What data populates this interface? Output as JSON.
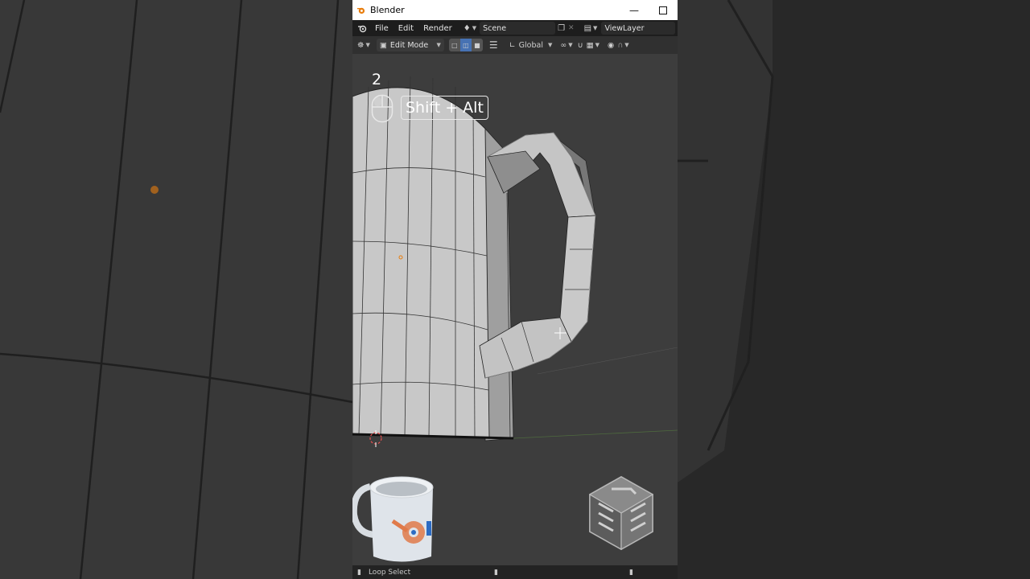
{
  "window": {
    "title": "Blender"
  },
  "menu": {
    "items": [
      "File",
      "Edit",
      "Render"
    ],
    "scene": "Scene",
    "view_layer": "ViewLayer"
  },
  "header": {
    "mode": "Edit Mode",
    "transform_orientation": "Global"
  },
  "overlay": {
    "number": "2",
    "shortcut": "Shift + Alt"
  },
  "status": {
    "action": "Loop Select"
  },
  "colors": {
    "accent": "#e87d0d",
    "active_select": "#4772b3",
    "viewport_bg": "#3d3d3d",
    "mesh_face": "#c8c8c8"
  }
}
